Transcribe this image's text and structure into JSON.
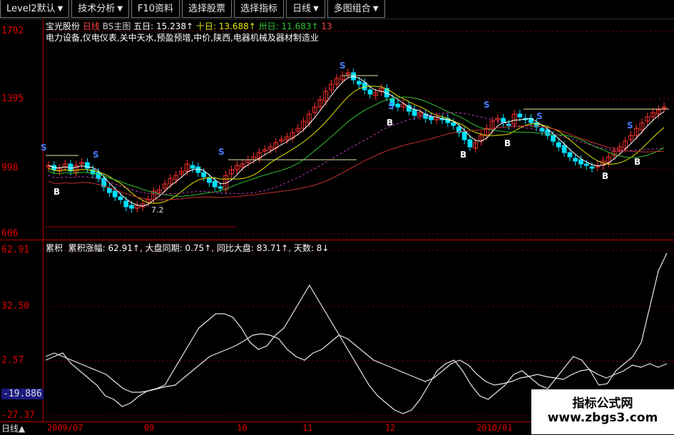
{
  "menu": [
    {
      "label": "Level2默认",
      "arrow": "▼"
    },
    {
      "label": "技术分析",
      "arrow": "▼"
    },
    {
      "label": "F10资料",
      "arrow": ""
    },
    {
      "label": "选择股票",
      "arrow": ""
    },
    {
      "label": "选择指标",
      "arrow": ""
    },
    {
      "label": "日线",
      "arrow": "▼"
    },
    {
      "label": "多图组合",
      "arrow": "▼"
    }
  ],
  "main_pane": {
    "stock_name": "宝光股份",
    "period": "日线",
    "indicator": "BS主图",
    "ma5_label": "五日:",
    "ma5_value": "15.238↑",
    "ma10_label": "十日:",
    "ma10_value": "13.688↑",
    "ma20_label": "卅日:",
    "ma20_value": "11.683↑",
    "extra": "13",
    "sector_text": "电力设备,仪电仪表,关中天水,预盈预增,中价,陕西,电器机械及器材制造业",
    "y_labels": [
      "1792",
      "1395",
      "998",
      "606"
    ],
    "bs_markers": [
      {
        "t": "S",
        "c": "#4a7bff"
      },
      {
        "t": "B",
        "c": "#ffffff"
      },
      {
        "t": "S",
        "c": "#4a7bff"
      },
      {
        "t": "S",
        "c": "#4a7bff"
      },
      {
        "t": "S",
        "c": "#4a7bff"
      },
      {
        "t": "S",
        "c": "#4a7bff"
      },
      {
        "t": "S",
        "c": "#4a7bff"
      },
      {
        "t": "S",
        "c": "#4a7bff"
      },
      {
        "t": "S",
        "c": "#4a7bff"
      },
      {
        "t": "B",
        "c": "#ffffff"
      },
      {
        "t": "B",
        "c": "#ffffff"
      },
      {
        "t": "B",
        "c": "#ffffff"
      },
      {
        "t": "B",
        "c": "#ffffff"
      },
      {
        "t": "B",
        "c": "#ffffff"
      }
    ],
    "small_label": "7.2"
  },
  "sub_pane": {
    "name": "累积",
    "cum_label": "累积涨幅:",
    "cum_value": "62.91↑",
    "market_label": "大盘同期:",
    "market_value": "0.75↑",
    "rel_label": "同比大盘:",
    "rel_value": "83.71↑",
    "days_label": "天数:",
    "days_value": "8↓",
    "y_labels": [
      "62.91",
      "32.50",
      "2.57",
      "-19.886",
      "-27.37"
    ]
  },
  "date_axis": {
    "period_button": "日线▲",
    "labels": [
      "2009/07",
      "09",
      "10",
      "11",
      "12",
      "2010/01"
    ]
  },
  "watermark": {
    "line1": "指标公式网",
    "line2": "www.zbgs3.com"
  },
  "colors": {
    "up": "#ff3030",
    "down": "#00e0ff",
    "frame": "#b40000",
    "buy": "#ffffff",
    "sell": "#4a7bff"
  }
}
